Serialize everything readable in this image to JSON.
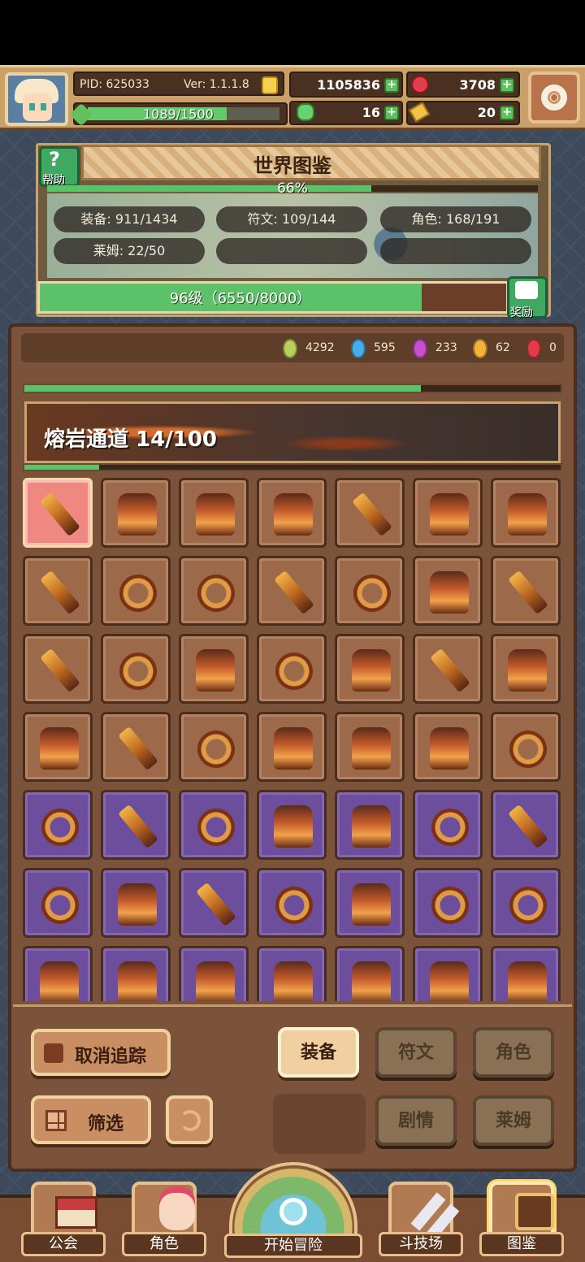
{
  "header": {
    "pid": "PID: 625033",
    "version": "Ver: 1.1.1.8",
    "xp_text": "1089/1500",
    "xp_fraction": 0.726,
    "gold": "1105836",
    "ruby": "3708",
    "clover": "16",
    "key": "20",
    "plus_label": "+"
  },
  "compendium": {
    "title": "世界图鉴",
    "help_label": "帮助",
    "percent_text": "66%",
    "percent_fraction": 0.66,
    "stats": {
      "equipment": "装备: 911/1434",
      "rune": "符文: 109/144",
      "character": "角色: 168/191",
      "slime": "莱姆: 22/50"
    },
    "level_text": "96级（6550/8000）",
    "level_fraction": 0.81875,
    "reward_label": "奖励"
  },
  "gems": [
    {
      "name": "green-gem",
      "color": "#b9cf5a",
      "value": "4292"
    },
    {
      "name": "blue-gem",
      "color": "#43aee8",
      "value": "595"
    },
    {
      "name": "purple-gem",
      "color": "#c84fd0",
      "value": "233"
    },
    {
      "name": "gold-gem",
      "color": "#f2b33a",
      "value": "62"
    },
    {
      "name": "red-gem",
      "color": "#e23c48",
      "value": "0"
    }
  ],
  "zone": {
    "title": "熔岩通道  14/100",
    "top_progress_fraction": 0.74,
    "zone_progress_fraction": 0.14
  },
  "grid": {
    "rows": [
      {
        "tier": "orange",
        "kinds": [
          "weapon",
          "armor",
          "armor",
          "armor",
          "weapon",
          "armor",
          "armor"
        ]
      },
      {
        "tier": "orange",
        "kinds": [
          "weapon",
          "ring",
          "ring",
          "weapon",
          "ring",
          "armor",
          "weapon"
        ]
      },
      {
        "tier": "orange",
        "kinds": [
          "weapon",
          "ring",
          "armor",
          "ring",
          "armor",
          "weapon",
          "armor"
        ]
      },
      {
        "tier": "orange",
        "kinds": [
          "armor",
          "weapon",
          "ring",
          "armor",
          "armor",
          "armor",
          "ring"
        ]
      },
      {
        "tier": "purple",
        "kinds": [
          "ring",
          "weapon",
          "ring",
          "armor",
          "armor",
          "ring",
          "weapon"
        ]
      },
      {
        "tier": "purple",
        "kinds": [
          "ring",
          "armor",
          "weapon",
          "ring",
          "armor",
          "ring",
          "ring"
        ]
      },
      {
        "tier": "purple",
        "kinds": [
          "armor",
          "armor",
          "armor",
          "armor",
          "armor",
          "armor",
          "armor"
        ]
      }
    ],
    "selected": [
      0,
      0
    ]
  },
  "buttons": {
    "cancel_track": "取消追踪",
    "equipment": "装备",
    "rune": "符文",
    "character": "角色",
    "filter": "筛选",
    "story": "剧情",
    "slime": "莱姆"
  },
  "nav": {
    "guild": "公会",
    "character": "角色",
    "start_adventure": "开始冒险",
    "arena": "斗技场",
    "compendium": "图鉴"
  }
}
